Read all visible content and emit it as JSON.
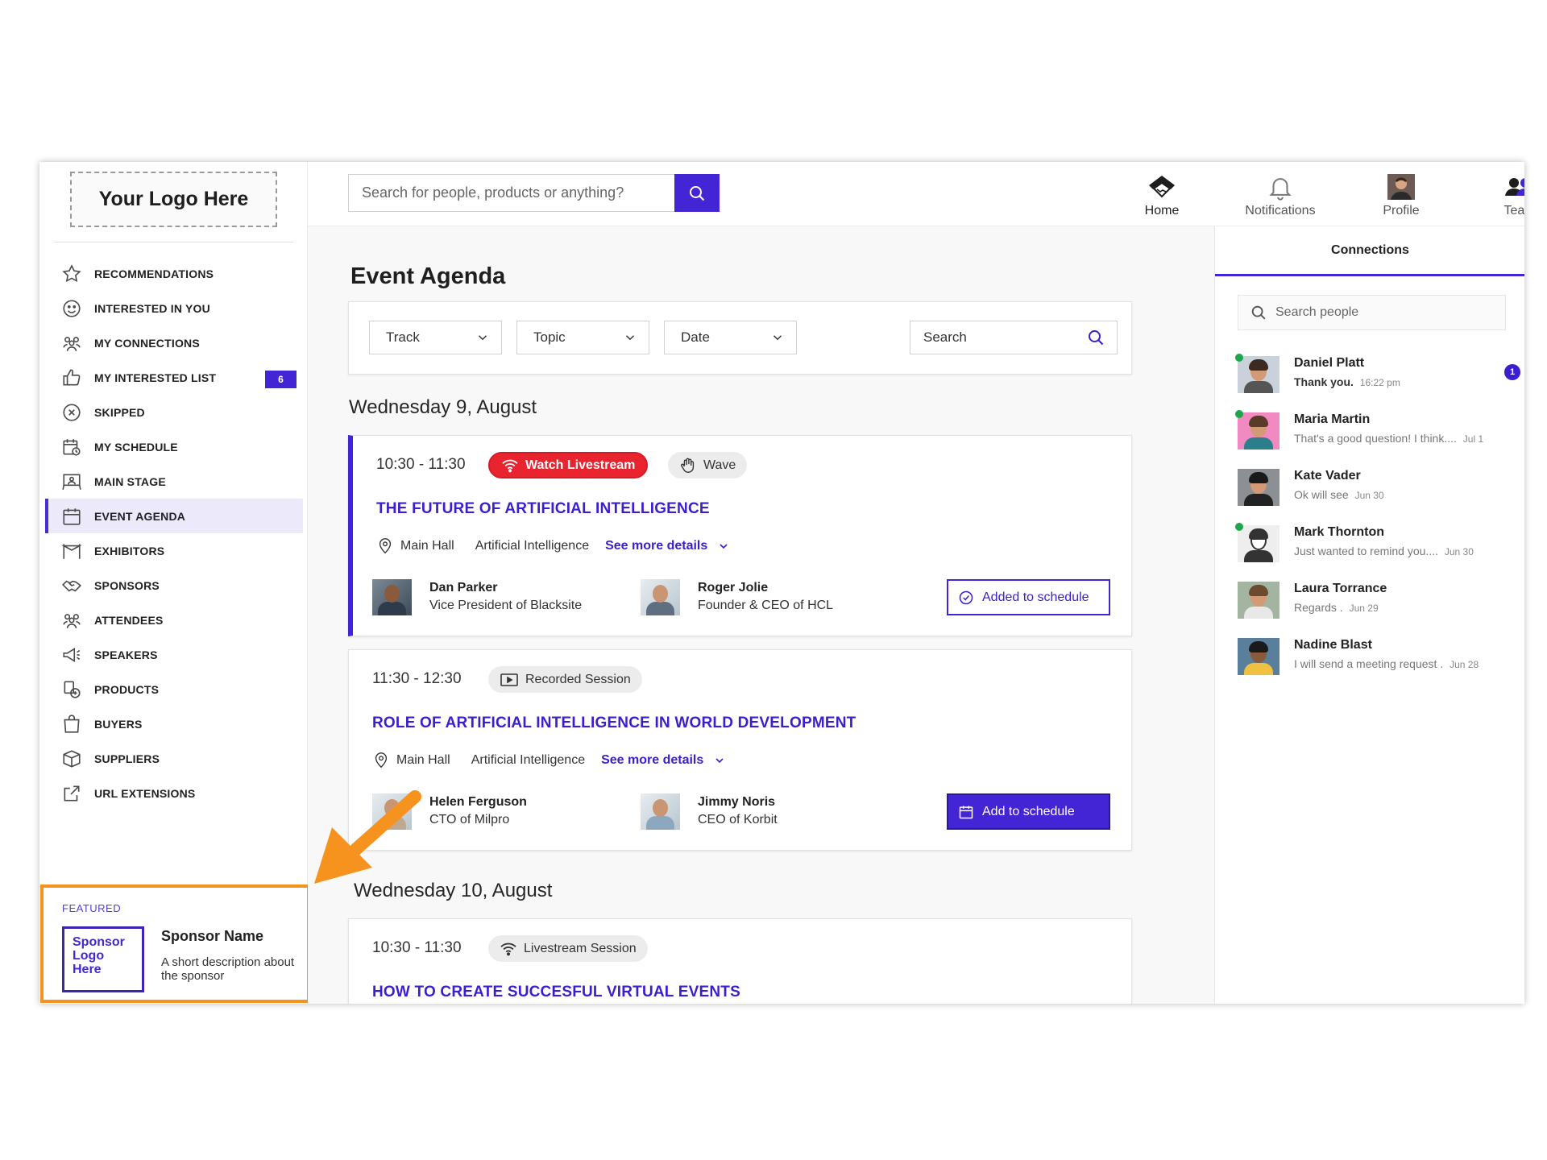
{
  "logo": {
    "text": "Your Logo Here"
  },
  "sidebar": {
    "items": [
      {
        "label": "RECOMMENDATIONS",
        "icon": "star-icon"
      },
      {
        "label": "INTERESTED IN YOU",
        "icon": "smiley-icon"
      },
      {
        "label": "MY CONNECTIONS",
        "icon": "people-icon"
      },
      {
        "label": "MY INTERESTED LIST",
        "icon": "thumbs-up-icon",
        "badge": "6"
      },
      {
        "label": "SKIPPED",
        "icon": "x-circle-icon"
      },
      {
        "label": "MY SCHEDULE",
        "icon": "calendar-clock-icon"
      },
      {
        "label": "MAIN STAGE",
        "icon": "stage-icon"
      },
      {
        "label": "EVENT AGENDA",
        "icon": "calendar-icon",
        "active": true
      },
      {
        "label": "EXHIBITORS",
        "icon": "booth-icon"
      },
      {
        "label": "SPONSORS",
        "icon": "handshake-icon"
      },
      {
        "label": "ATTENDEES",
        "icon": "group-icon"
      },
      {
        "label": "SPEAKERS",
        "icon": "megaphone-icon"
      },
      {
        "label": "PRODUCTS",
        "icon": "products-icon"
      },
      {
        "label": "BUYERS",
        "icon": "shopping-bag-icon"
      },
      {
        "label": "SUPPLIERS",
        "icon": "box-icon"
      },
      {
        "label": "URL EXTENSIONS",
        "icon": "external-link-icon"
      }
    ]
  },
  "featured": {
    "label": "FEATURED",
    "logo_line1": "Sponsor",
    "logo_line2": "Logo",
    "logo_line3": "Here",
    "name": "Sponsor Name",
    "description": "A short description about the sponsor"
  },
  "topbar": {
    "search_placeholder": "Search for people, products or anything?",
    "nav": [
      {
        "label": "Home",
        "icon": "home-icon"
      },
      {
        "label": "Notifications",
        "icon": "bell-icon"
      },
      {
        "label": "Profile",
        "icon": "profile-avatar"
      },
      {
        "label": "Team",
        "icon": "team-icon"
      }
    ]
  },
  "agenda": {
    "title": "Event Agenda",
    "filters": {
      "track": "Track",
      "topic": "Topic",
      "date": "Date",
      "search": "Search"
    },
    "days": [
      {
        "heading": "Wednesday 9, August"
      },
      {
        "heading": "Wednesday 10, August"
      }
    ],
    "sessions": [
      {
        "time": "10:30 - 11:30",
        "pills": [
          "Watch Livestream",
          "Wave"
        ],
        "title": "THE FUTURE OF ARTIFICIAL INTELLIGENCE",
        "location": "Main Hall",
        "topic": "Artificial Intelligence",
        "details": "See more details",
        "speakers": [
          {
            "name": "Dan Parker",
            "role": "Vice President of Blacksite"
          },
          {
            "name": "Roger Jolie",
            "role": "Founder & CEO of HCL"
          }
        ],
        "action": "Added to schedule"
      },
      {
        "time": "11:30 - 12:30",
        "pills": [
          "Recorded Session"
        ],
        "title": "ROLE OF ARTIFICIAL INTELLIGENCE IN WORLD DEVELOPMENT",
        "location": "Main Hall",
        "topic": "Artificial Intelligence",
        "details": "See more details",
        "speakers": [
          {
            "name": "Helen Ferguson",
            "role": "CTO of Milpro"
          },
          {
            "name": "Jimmy Noris",
            "role": "CEO of Korbit"
          }
        ],
        "action": "Add to schedule"
      },
      {
        "time": "10:30 - 11:30",
        "pills": [
          "Livestream Session"
        ],
        "title": "HOW TO CREATE SUCCESFUL VIRTUAL EVENTS"
      }
    ]
  },
  "connections": {
    "tab": "Connections",
    "search_placeholder": "Search people",
    "contacts": [
      {
        "name": "Daniel Platt",
        "prefix": "Thank you.",
        "message": "",
        "time": "16:22 pm",
        "online": true,
        "unread": "1"
      },
      {
        "name": "Maria Martin",
        "prefix": "",
        "message": "That's a good question! I think....",
        "time": "Jul 1",
        "online": true
      },
      {
        "name": "Kate Vader",
        "prefix": "",
        "message": "Ok will see",
        "time": "Jun 30",
        "online": false
      },
      {
        "name": "Mark Thornton",
        "prefix": "",
        "message": "Just wanted to remind you....",
        "time": "Jun 30",
        "online": true
      },
      {
        "name": "Laura Torrance",
        "prefix": "",
        "message": "Regards .",
        "time": "Jun 29",
        "online": false
      },
      {
        "name": "Nadine Blast",
        "prefix": "",
        "message": "I will send a meeting request .",
        "time": "Jun 28",
        "online": false
      }
    ]
  },
  "colors": {
    "accent": "#4325d6",
    "live": "#e8242e",
    "callout": "#f6931e",
    "online": "#1aa84b"
  }
}
